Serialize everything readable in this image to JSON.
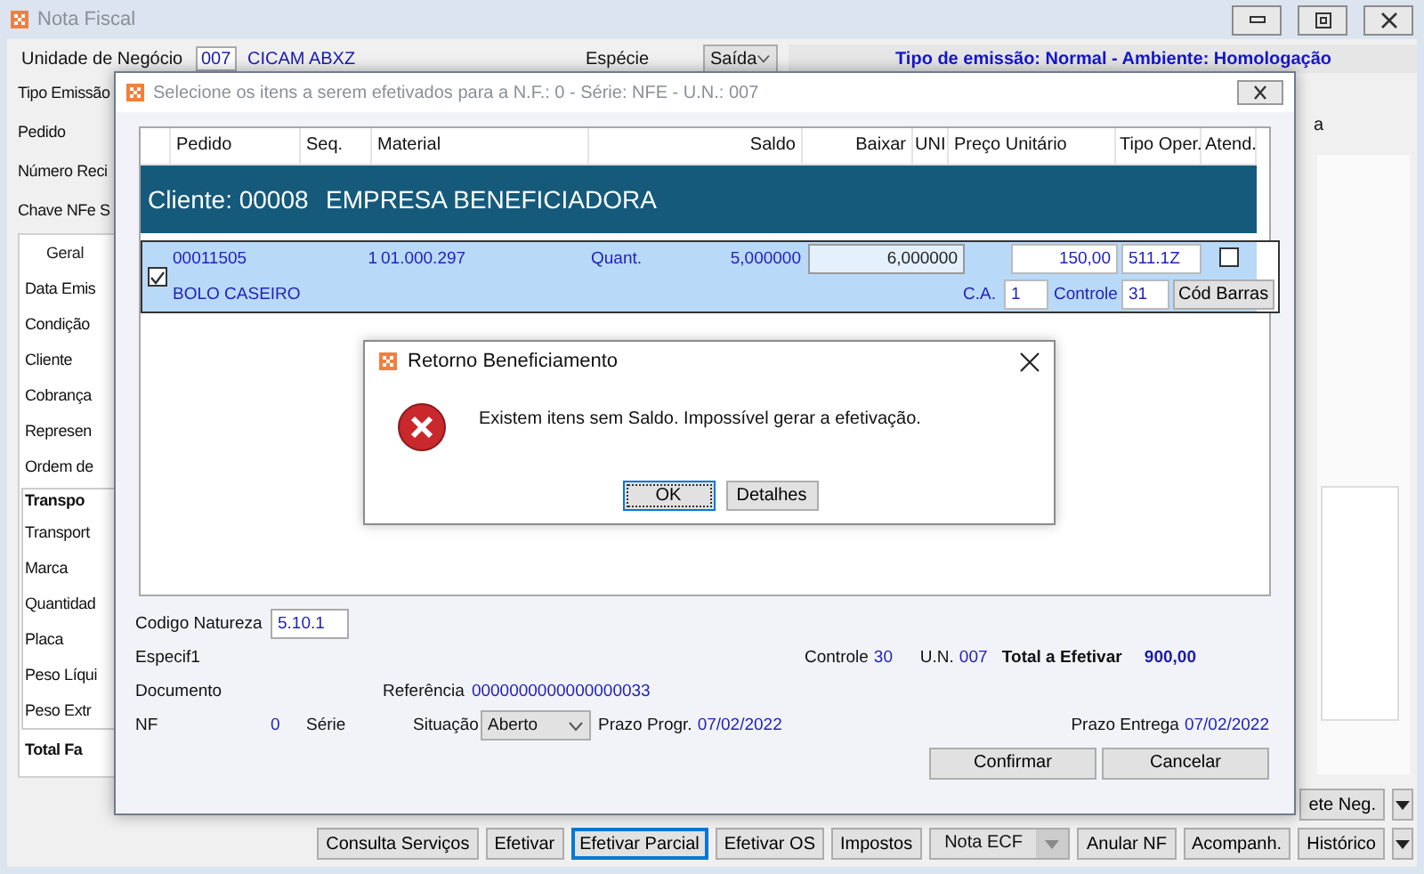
{
  "main_window": {
    "title": "Nota Fiscal",
    "top_row": {
      "unit_label": "Unidade de Negócio",
      "unit_code": "007",
      "unit_name": "CICAM ABXZ",
      "species_label": "Espécie",
      "species_value": "Saída",
      "emission_info": "Tipo de emissão: Normal - Ambiente: Homologação"
    },
    "left_labels": [
      "Tipo Emissão",
      "Pedido",
      "Número Reci",
      "Chave NFe S"
    ],
    "right_label": "a",
    "tabs": [
      {
        "label": "Geral",
        "selected": true
      }
    ],
    "tab_labels": [
      "Data Emis",
      "Condição",
      "Cliente",
      "Cobrança",
      "Represen",
      "Ordem de"
    ],
    "group": {
      "title": "Transpo",
      "labels": [
        "Transport",
        "Marca",
        "Quantidad",
        "Placa",
        "Peso Líqui",
        "Peso Extr"
      ]
    },
    "total_label": "Total Fa",
    "button_rows": [
      [
        {
          "kind": "button",
          "label": "ete Neg.",
          "focused": false
        },
        {
          "kind": "arrow"
        }
      ],
      [
        {
          "kind": "button",
          "label": "Consulta Serviços",
          "focused": false
        },
        {
          "kind": "button",
          "label": "Efetivar",
          "focused": false
        },
        {
          "kind": "button",
          "label": "Efetivar Parcial",
          "focused": true
        },
        {
          "kind": "button",
          "label": "Efetivar OS",
          "focused": false
        },
        {
          "kind": "button",
          "label": "Impostos",
          "focused": false
        },
        {
          "kind": "split",
          "label": "Nota ECF",
          "focused": false
        },
        {
          "kind": "button",
          "label": "Anular NF",
          "focused": false
        },
        {
          "kind": "button",
          "label": "Acompanh.",
          "focused": false
        },
        {
          "kind": "button",
          "label": "Histórico",
          "focused": false
        },
        {
          "kind": "arrow"
        }
      ]
    ]
  },
  "dialog": {
    "title": "Selecione os itens a serem efetivados para a N.F.: 0 - Série: NFE - U.N.: 007",
    "columns": [
      "Pedido",
      "Seq.",
      "Material",
      "Saldo",
      "Baixar",
      "UNI",
      "Preço Unitário",
      "Tipo Oper.",
      "Atend."
    ],
    "client_band": {
      "code": "Cliente: 00008",
      "name": "EMPRESA BENEFICIADORA"
    },
    "items": [
      {
        "checked": true,
        "pedido": "00011505",
        "seq": "1",
        "material": "01.000.297",
        "qty_label": "Quant.",
        "saldo": "5,000000",
        "baixar": "6,000000",
        "price": "150,00",
        "tipo_oper": "511.1Z",
        "atend": false,
        "description": "BOLO CASEIRO",
        "ca_label": "C.A.",
        "ca": "1",
        "controle_label": "Controle",
        "controle": "31",
        "barcode_button": "Cód Barras"
      }
    ],
    "natureza_label": "Codigo Natureza",
    "natureza": "5.10.1",
    "especif_label": "Especif1",
    "controle_label": "Controle",
    "controle": "30",
    "un_label": "U.N.",
    "un": "007",
    "total_label": "Total a Efetivar",
    "total": "900,00",
    "documento_label": "Documento",
    "referencia_label": "Referência",
    "referencia": "0000000000000000033",
    "nf_label": "NF",
    "nf": "0",
    "serie_label": "Série",
    "situacao_label": "Situação",
    "situacao": "Aberto",
    "prazo_progr_label": "Prazo Progr.",
    "prazo_progr": "07/02/2022",
    "prazo_entrega_label": "Prazo Entrega",
    "prazo_entrega": "07/02/2022",
    "buttons": [
      "Confirmar",
      "Cancelar"
    ]
  },
  "message_box": {
    "title": "Retorno Beneficiamento",
    "message": "Existem itens sem Saldo. Impossível gerar a efetivação.",
    "buttons": [
      {
        "label": "OK",
        "selected": true
      },
      {
        "label": "Detalhes",
        "selected": false
      }
    ]
  }
}
